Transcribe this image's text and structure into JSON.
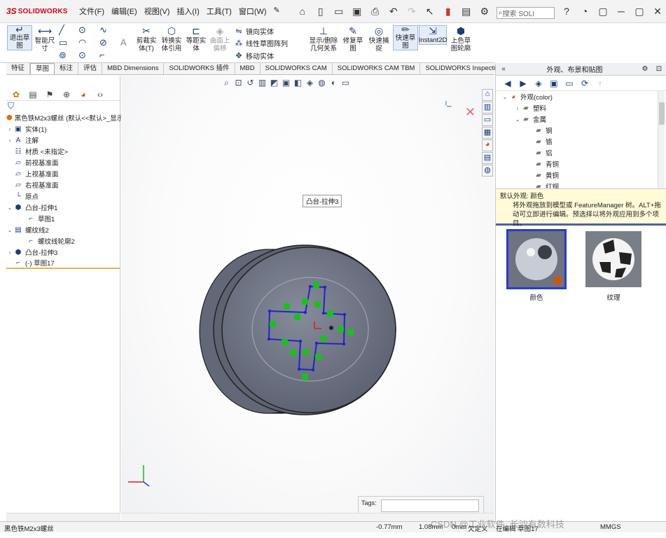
{
  "app": {
    "logo_ds": "3S",
    "logo_text": "SOLIDWORKS",
    "menu": [
      "文件(F)",
      "编辑(E)",
      "视图(V)",
      "插入(I)",
      "工具(T)",
      "窗口(W)"
    ],
    "search_placeholder": "搜索 SOLI",
    "window_buttons": [
      "?",
      "◔",
      "▢",
      "─",
      "▢",
      "✕"
    ]
  },
  "commands": {
    "exit_sketch": "退出草图",
    "smart_dim": "智能尺寸",
    "trim": "剪裁实体(T)",
    "convert": "转换实体引用",
    "offset": "等距实体",
    "surface_offset": "曲面上偏移",
    "mirror": "镜向实体",
    "linear_pattern": "线性草图阵列",
    "move": "移动实体",
    "show_relations": "显示/删除几何关系",
    "repair": "修复草图",
    "quick_snap": "快速捕捉",
    "rapid_sketch": "快速草图",
    "instant2d": "Instant2D",
    "shaded_contour": "上色草图轮廓"
  },
  "tabs": [
    "特征",
    "草图",
    "标注",
    "评估",
    "MBD Dimensions",
    "SOLIDWORKS 插件",
    "MBD",
    "SOLIDWORKS CAM",
    "SOLIDWORKS CAM TBM",
    "SOLIDWORKS Inspection"
  ],
  "active_tab": "草图",
  "feature_tree": {
    "root": "黑色铁M2x3螺丝 (默认<<默认>_显示",
    "items": [
      {
        "label": "实体(1)",
        "icon": "solid-bodies-icon",
        "indent": 0,
        "arrow": "›"
      },
      {
        "label": "注解",
        "icon": "annotations-icon",
        "indent": 0,
        "arrow": "›"
      },
      {
        "label": "材质 <未指定>",
        "icon": "material-icon",
        "indent": 0,
        "arrow": ""
      },
      {
        "label": "前视基准面",
        "icon": "plane-icon",
        "indent": 0,
        "arrow": ""
      },
      {
        "label": "上视基准面",
        "icon": "plane-icon",
        "indent": 0,
        "arrow": ""
      },
      {
        "label": "右视基准面",
        "icon": "plane-icon",
        "indent": 0,
        "arrow": ""
      },
      {
        "label": "原点",
        "icon": "origin-icon",
        "indent": 0,
        "arrow": ""
      },
      {
        "label": "凸台-拉伸1",
        "icon": "extrude-icon",
        "indent": 0,
        "arrow": "⌄"
      },
      {
        "label": "草图1",
        "icon": "sketch-icon",
        "indent": 1,
        "arrow": ""
      },
      {
        "label": "螺纹线2",
        "icon": "thread-icon",
        "indent": 0,
        "arrow": "⌄"
      },
      {
        "label": "螺纹线轮廓2",
        "icon": "sketch-icon",
        "indent": 1,
        "arrow": ""
      },
      {
        "label": "凸台-拉伸3",
        "icon": "extrude-icon",
        "indent": 0,
        "arrow": "›"
      },
      {
        "label": "(-) 草图17",
        "icon": "sketch-icon",
        "indent": 0,
        "arrow": ""
      }
    ]
  },
  "graphics": {
    "tooltip": "凸台-拉伸3",
    "tags_label": "Tags:"
  },
  "taskpane": {
    "title": "外观、布景和贴图",
    "tree": [
      {
        "label": "外观(color)",
        "indent": 0,
        "arrow": "⌄"
      },
      {
        "label": "塑料",
        "indent": 1,
        "arrow": "›"
      },
      {
        "label": "金属",
        "indent": 1,
        "arrow": "⌄"
      },
      {
        "label": "钢",
        "indent": 2,
        "arrow": ""
      },
      {
        "label": "铬",
        "indent": 2,
        "arrow": ""
      },
      {
        "label": "铝",
        "indent": 2,
        "arrow": ""
      },
      {
        "label": "青铜",
        "indent": 2,
        "arrow": ""
      },
      {
        "label": "黄铜",
        "indent": 2,
        "arrow": ""
      },
      {
        "label": "红铜",
        "indent": 2,
        "arrow": ""
      }
    ],
    "info_head": "默认外观: 颜色",
    "info_body": "将外观拖放到模型或 FeatureManager 树。ALT+拖动可立即进行编辑。预选择以将外观应用到多个项目。",
    "swatches": [
      "颜色",
      "纹理"
    ]
  },
  "status": {
    "file": "黑色铁M2x3螺丝",
    "x": "-0.77mm",
    "y": "1.08mm",
    "z": "0mm",
    "state": "欠定义",
    "editing": "在编辑 草图17",
    "units": "MMGS"
  },
  "watermark": "CSDN @工业软件_长沙有数科技",
  "colors": {
    "brand": "#d6001c",
    "accent": "#1d3c78",
    "sketch": "#2222cc",
    "relation": "#18c218"
  }
}
